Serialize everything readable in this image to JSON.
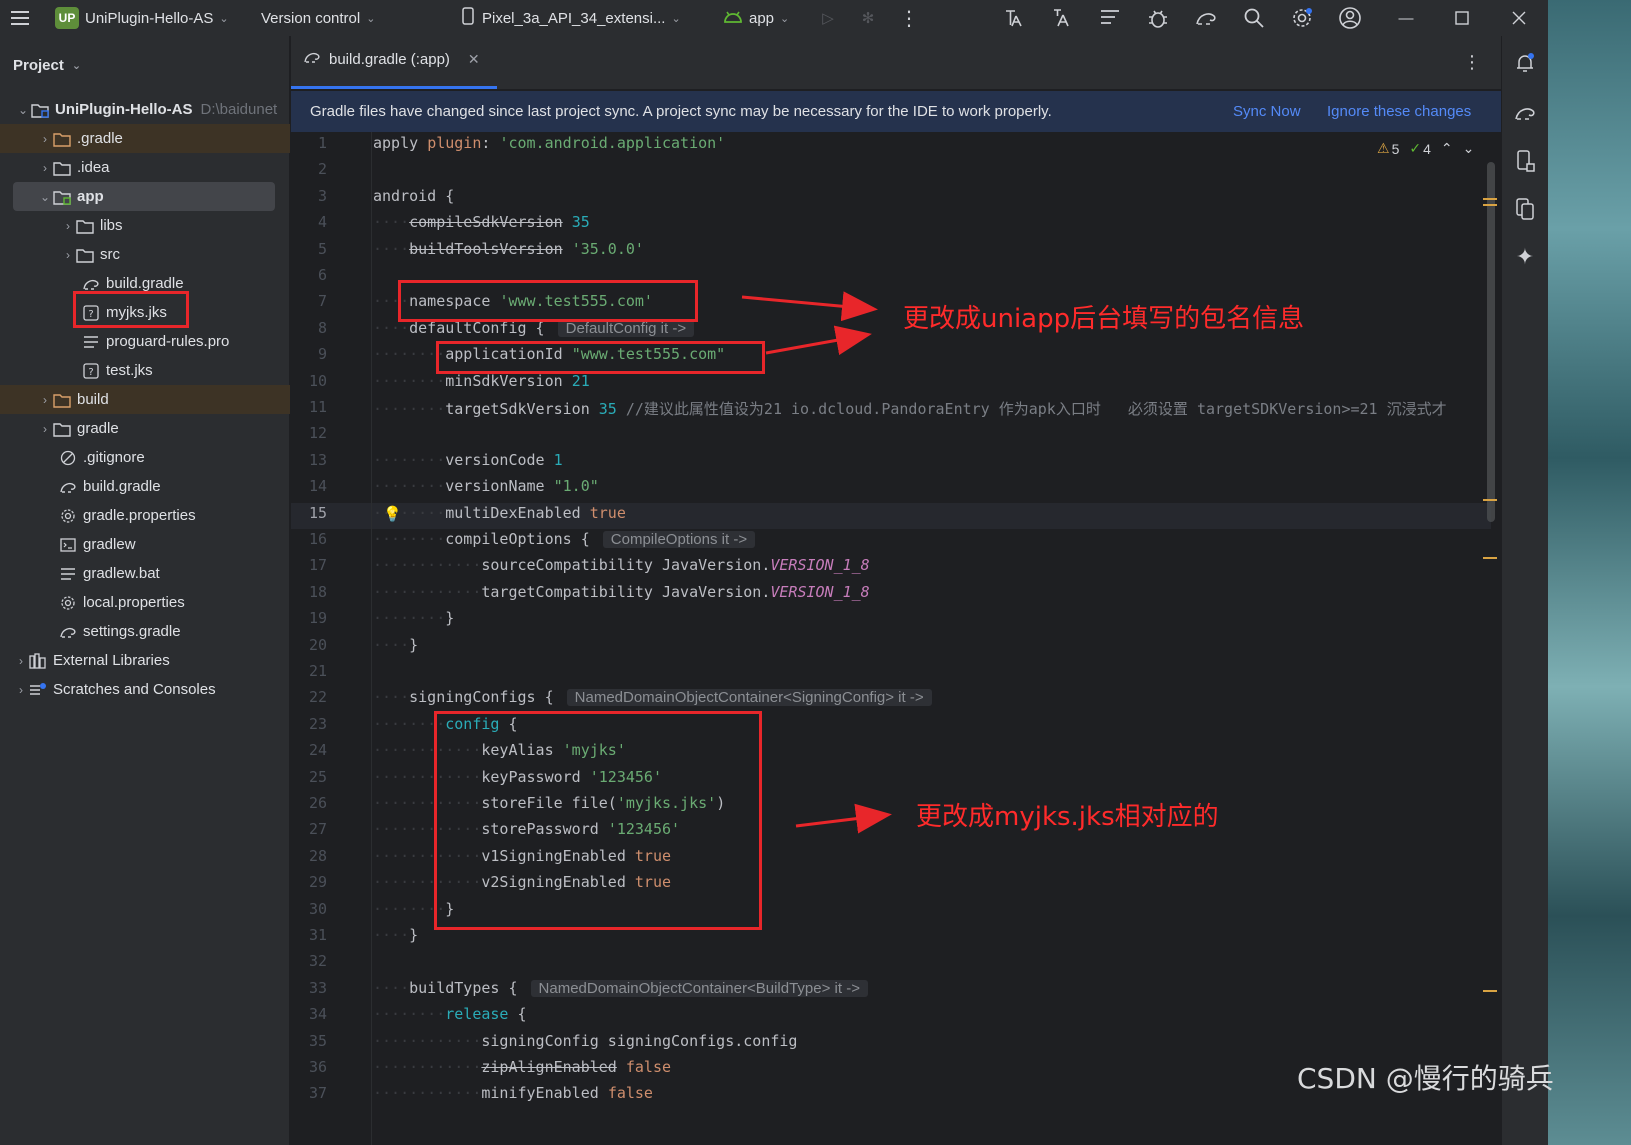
{
  "titlebar": {
    "project_badge": "UP",
    "project_name": "UniPlugin-Hello-AS",
    "vcs": "Version control",
    "device": "Pixel_3a_API_34_extensi...",
    "run_config": "app"
  },
  "project_panel": {
    "title": "Project",
    "root_name": "UniPlugin-Hello-AS",
    "root_path": "D:\\baidunet",
    "items": [
      {
        "label": ".gradle"
      },
      {
        "label": ".idea"
      },
      {
        "label": "app"
      },
      {
        "label": "libs"
      },
      {
        "label": "src"
      },
      {
        "label": "build.gradle"
      },
      {
        "label": "myjks.jks"
      },
      {
        "label": "proguard-rules.pro"
      },
      {
        "label": "test.jks"
      },
      {
        "label": "build"
      },
      {
        "label": "gradle"
      },
      {
        "label": ".gitignore"
      },
      {
        "label": "build.gradle"
      },
      {
        "label": "gradle.properties"
      },
      {
        "label": "gradlew"
      },
      {
        "label": "gradlew.bat"
      },
      {
        "label": "local.properties"
      },
      {
        "label": "settings.gradle"
      },
      {
        "label": "External Libraries"
      },
      {
        "label": "Scratches and Consoles"
      }
    ]
  },
  "editor": {
    "tab_label": "build.gradle (:app)",
    "banner": {
      "message": "Gradle files have changed since last project sync. A project sync may be necessary for the IDE to work properly.",
      "sync_now": "Sync Now",
      "ignore": "Ignore these changes"
    },
    "warnings": "5",
    "weak_warnings": "4",
    "line_numbers": [
      "1",
      "2",
      "3",
      "4",
      "5",
      "6",
      "7",
      "8",
      "9",
      "10",
      "11",
      "12",
      "13",
      "14",
      "15",
      "16",
      "17",
      "18",
      "19",
      "20",
      "21",
      "22",
      "23",
      "24",
      "25",
      "26",
      "27",
      "28",
      "29",
      "30",
      "31",
      "32",
      "33",
      "34",
      "35",
      "36",
      "37"
    ],
    "hints": {
      "default_config": "DefaultConfig it ->",
      "compile_options": "CompileOptions it ->",
      "signing_configs": "NamedDomainObjectContainer<SigningConfig> it ->",
      "build_types": "NamedDomainObjectContainer<BuildType> it ->"
    },
    "comment_line_11": "//建议此属性值设为21 io.dcloud.PandoraEntry 作为apk入口时   必须设置 targetSDKVersion>=21 沉浸式才"
  },
  "annotations": {
    "note_package": "更改成uniapp后台填写的包名信息",
    "note_keystore": "更改成myjks.jks相对应的"
  },
  "watermark": "CSDN @慢行的骑兵"
}
